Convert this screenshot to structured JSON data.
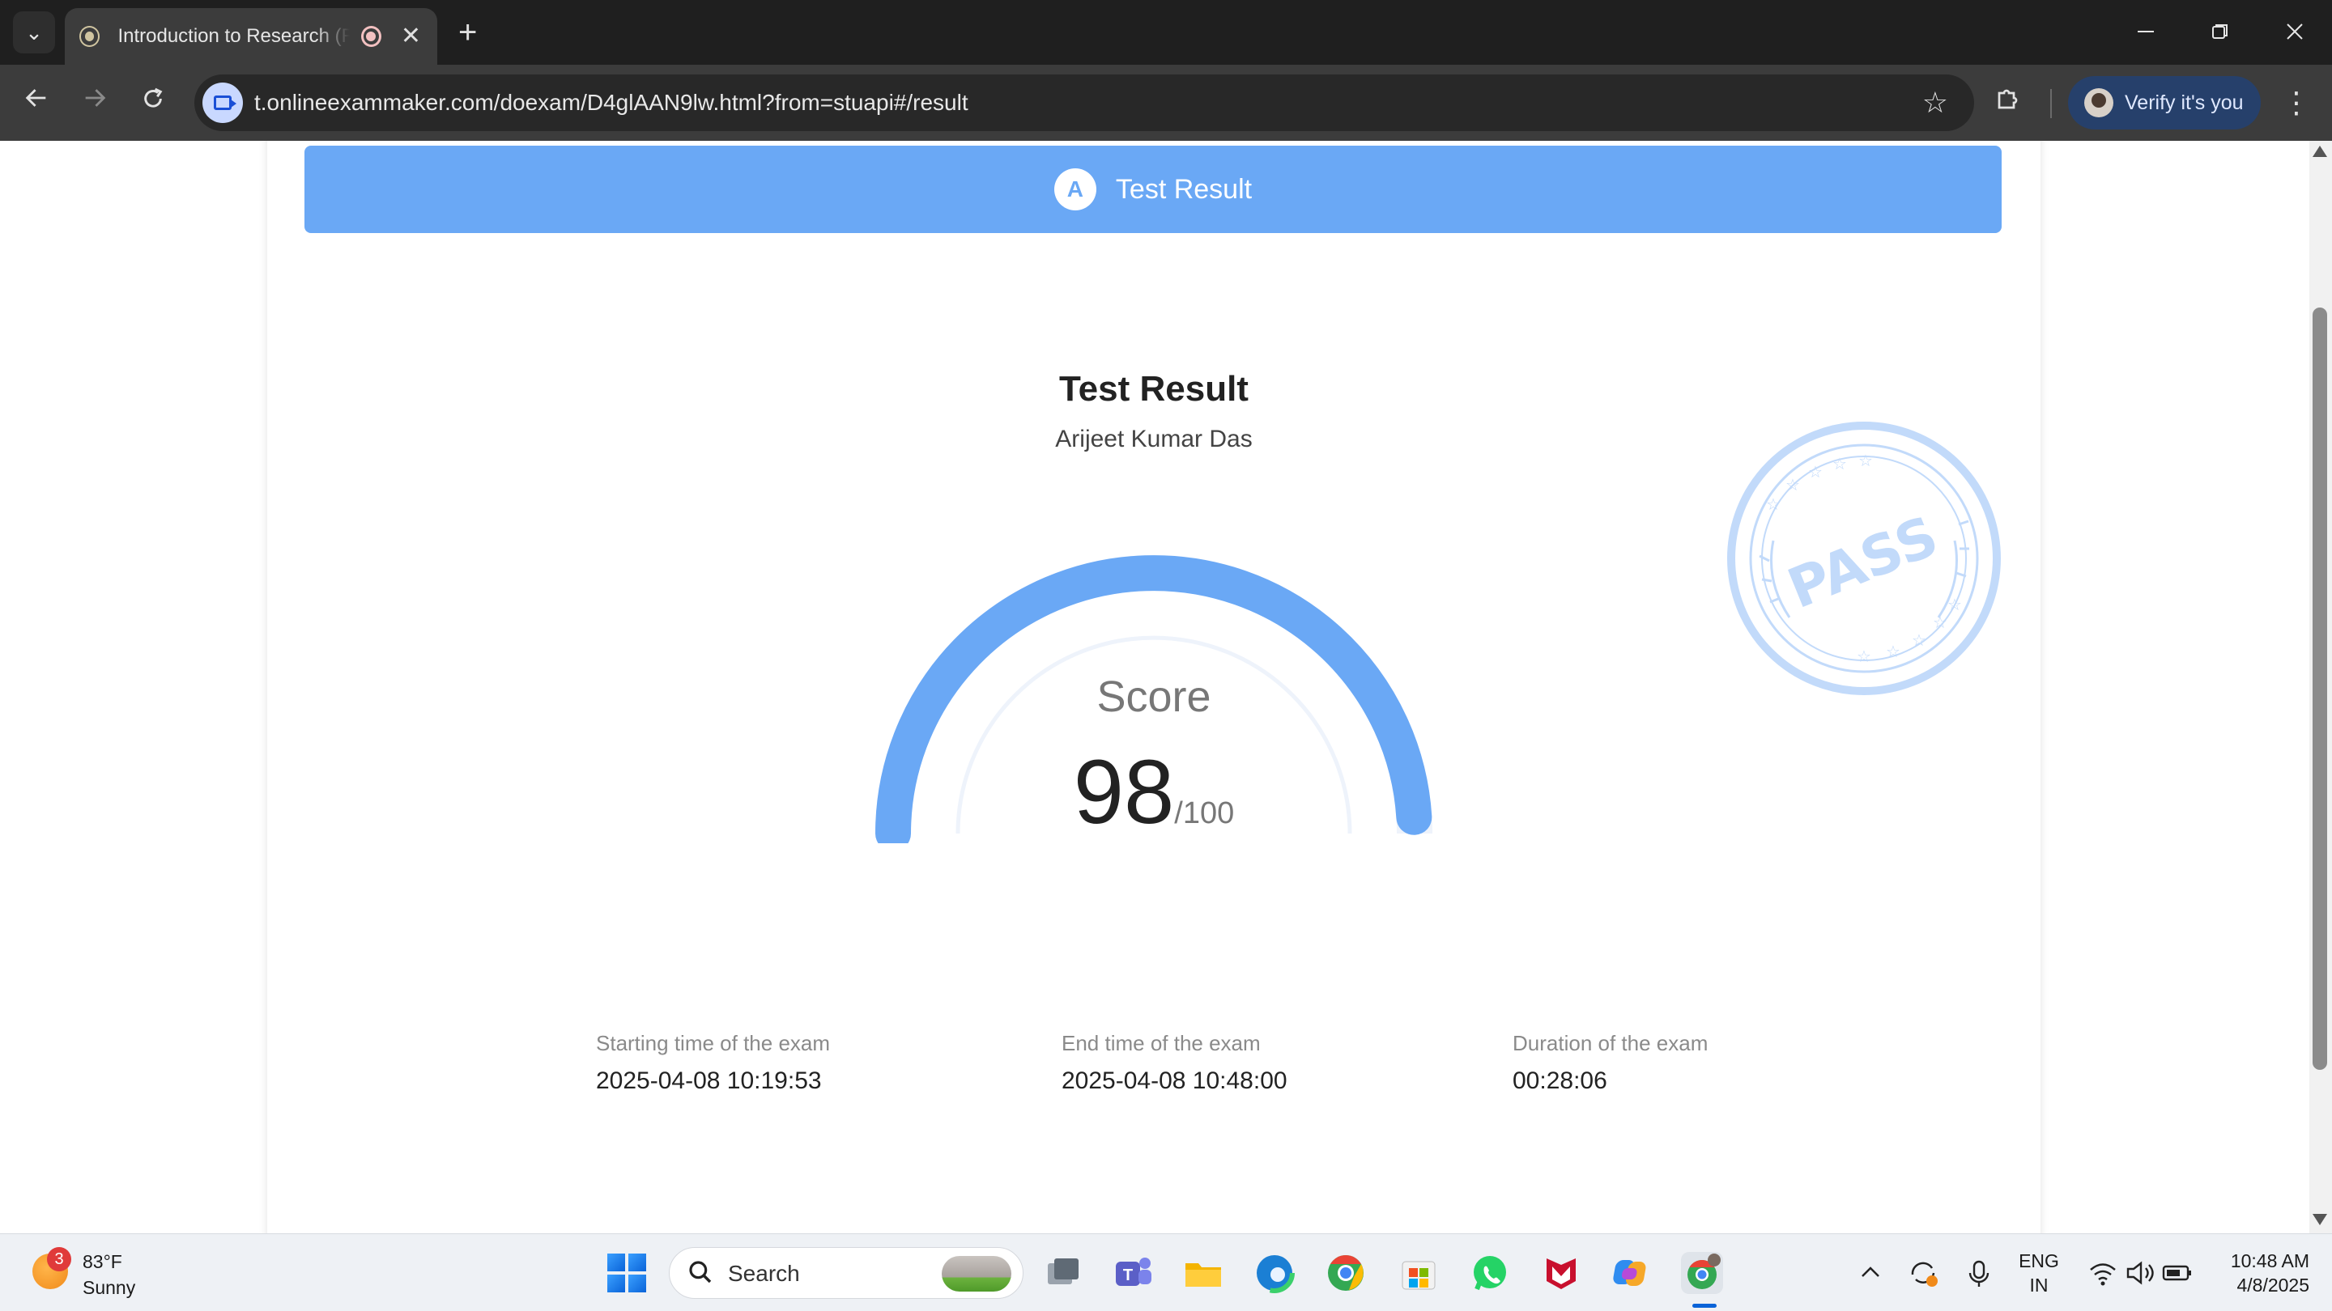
{
  "browser": {
    "tab_title": "Introduction to Research (Research)",
    "url": "t.onlineexammaker.com/doexam/D4glAAN9lw.html?from=stuapi#/result",
    "profile_button": "Verify it's you",
    "new_tab": "+",
    "tab_close": "✕"
  },
  "page": {
    "banner_title": "Test Result",
    "banner_icon_letter": "A",
    "result_title": "Test Result",
    "candidate_name": "Arijeet Kumar Das",
    "score_label": "Score",
    "score_value": "98",
    "score_max": "/100",
    "score_fraction": 0.98,
    "stamp_text": "PASS",
    "exam_info": [
      {
        "label": "Starting time of the exam",
        "value": "2025-04-08 10:19:53"
      },
      {
        "label": "End time of the exam",
        "value": "2025-04-08 10:48:00"
      },
      {
        "label": "Duration of the exam",
        "value": "00:28:06"
      }
    ],
    "colors": {
      "accent": "#6aa8f5",
      "stamp": "#c2dafa",
      "gauge_track": "#eef3fb"
    }
  },
  "taskbar": {
    "weather_temp": "83°F",
    "weather_cond": "Sunny",
    "weather_badge": "3",
    "search_label": "Search",
    "lang_top": "ENG",
    "lang_bottom": "IN",
    "time": "10:48 AM",
    "date": "4/8/2025",
    "apps": [
      "task-view",
      "teams",
      "file-explorer",
      "edge",
      "chrome",
      "microsoft-store",
      "whatsapp",
      "mcafee",
      "copilot",
      "chrome-profile"
    ]
  }
}
